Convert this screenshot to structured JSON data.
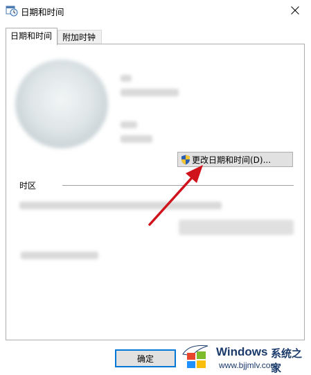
{
  "window": {
    "title": "日期和时间"
  },
  "tabs": [
    {
      "label": "日期和时间"
    },
    {
      "label": "附加时钟"
    }
  ],
  "main": {
    "change_button_label": "更改日期和时间(D)...",
    "timezone_section_label": "时区"
  },
  "footer": {
    "ok_label": "确定"
  },
  "watermark": {
    "brand": "Windows",
    "cn": "系统之家",
    "url": "www.bjjmlv.com"
  },
  "colors": {
    "accent": "#0078d7",
    "arrow": "#d0121b"
  }
}
